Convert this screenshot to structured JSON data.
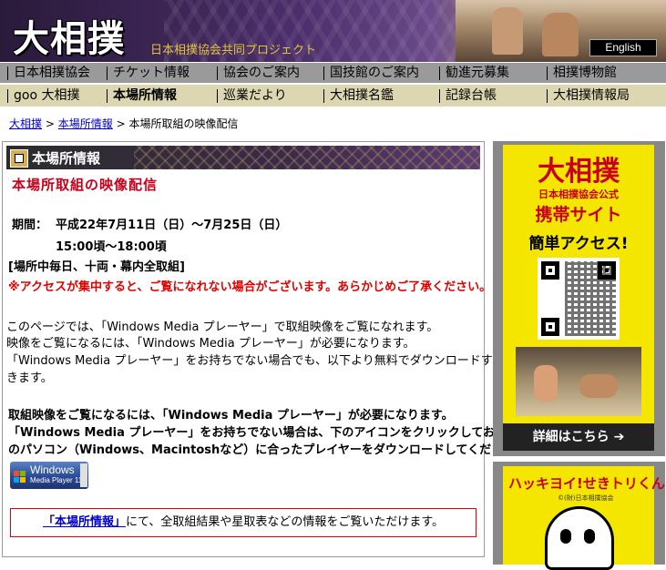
{
  "header": {
    "logo": "大相撲",
    "tagline": "日本相撲協会共同プロジェクト",
    "english": "English"
  },
  "nav1": [
    "日本相撲協会",
    "チケット情報",
    "協会のご案内",
    "国技館のご案内",
    "勧進元募集",
    "相撲博物館"
  ],
  "nav2": [
    "goo 大相撲",
    "本場所情報",
    "巡業だより",
    "大相撲名鑑",
    "記録台帳",
    "大相撲情報局"
  ],
  "breadcrumb": {
    "home": "大相撲",
    "sep1": ">",
    "section": "本場所情報",
    "sep2": ">",
    "current": "本場所取組の映像配信"
  },
  "main": {
    "section_title": "本場所情報",
    "heading": "本場所取組の映像配信",
    "period_label": "期間：",
    "period_dates": "平成22年7月11日（日）〜7月25日（日）",
    "period_time": "15:00頃〜18:00頃",
    "schedule_note": "[場所中毎日、十両・幕内全取組]",
    "warning": "※アクセスが集中すると、ご覧になれない場合がございます。あらかじめご了承ください。",
    "intro_1": "このページでは、「Windows Media プレーヤー」で取組映像をご覧になれます。",
    "intro_2": "映像をご覧になるには、「Windows Media プレーヤー」が必要になります。",
    "intro_3": "「Windows Media プレーヤー」をお持ちでない場合でも、以下より無料でダウンロードすることがで",
    "intro_4": "きます。",
    "req_1": "取組映像をご覧になるには、「Windows Media プレーヤー」が必要になります。",
    "req_2": "「Windows Media プレーヤー」をお持ちでない場合は、下のアイコンをクリックしてお使い",
    "req_3": "のパソコン（Windows、Macintoshなど）に合ったプレイヤーをダウンロードしてください。",
    "wmp_title": "Windows",
    "wmp_sub": "Media Player 11",
    "notice_link": "「本場所情報」",
    "notice_text": "にて、全取組結果や星取表などの情報をご覧いただけます。"
  },
  "ads": {
    "mobile": {
      "title": "大相撲",
      "subtitle": "日本相撲協会公式",
      "mobile_site": "携帯サイト",
      "easy_access": "簡単アクセス!",
      "details": "詳細はこちら"
    },
    "character": {
      "title": "ハッキヨイ!せきトリくん",
      "small": "©(財)日本相撲協会"
    }
  }
}
